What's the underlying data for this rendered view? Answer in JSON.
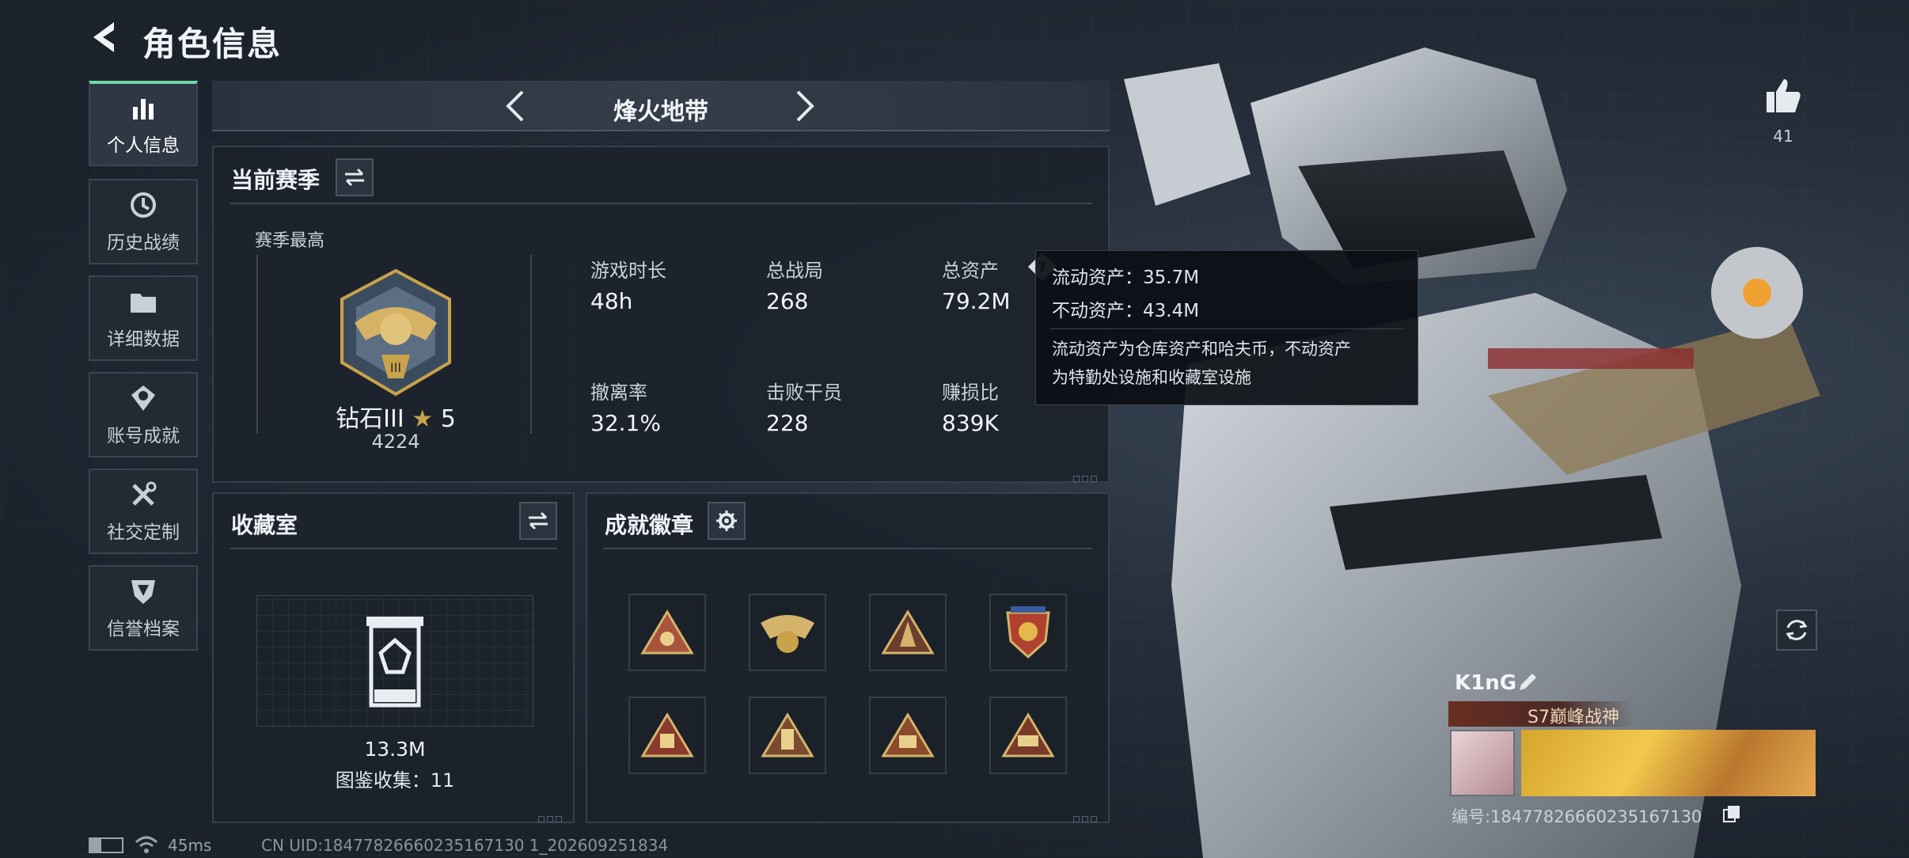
{
  "header": {
    "title": "角色信息"
  },
  "sidebar": {
    "items": [
      {
        "label": "个人信息",
        "icon": "bar-chart-icon",
        "active": true
      },
      {
        "label": "历史战绩",
        "icon": "clock-icon",
        "active": false
      },
      {
        "label": "详细数据",
        "icon": "folder-icon",
        "active": false
      },
      {
        "label": "账号成就",
        "icon": "medal-icon",
        "active": false
      },
      {
        "label": "社交定制",
        "icon": "wrench-icon",
        "active": false
      },
      {
        "label": "信誉档案",
        "icon": "shield-icon",
        "active": false
      }
    ]
  },
  "mode": {
    "label": "烽火地带"
  },
  "season": {
    "title": "当前赛季",
    "best_label": "赛季最高",
    "rank_name": "钻石III",
    "rank_stars": "5",
    "rank_score": "4224",
    "stats": [
      {
        "label": "游戏时长",
        "value": "48h"
      },
      {
        "label": "总战局",
        "value": "268"
      },
      {
        "label": "总资产",
        "value": "79.2M"
      },
      {
        "label": "撤离率",
        "value": "32.1%"
      },
      {
        "label": "击败干员",
        "value": "228"
      },
      {
        "label": "赚损比",
        "value": "839K"
      }
    ]
  },
  "tooltip": {
    "liquid": "流动资产：35.7M",
    "fixed": "不动资产：43.4M",
    "desc_line1": "流动资产为仓库资产和哈夫币，不动资产",
    "desc_line2": "为特勤处设施和收藏室设施"
  },
  "collection": {
    "title": "收藏室",
    "value": "13.3M",
    "codex": "图鉴收集：11"
  },
  "badges": {
    "title": "成就徽章",
    "count": 8
  },
  "likes": {
    "count": "41"
  },
  "player": {
    "name": "K1nG",
    "title": "S7巅峰战神",
    "id_text": "编号:18477826660235167130"
  },
  "status": {
    "ping": "45ms",
    "uid": "CN UID:18477826660235167130 1_202609251834"
  },
  "colors": {
    "accent": "#6fd7a8",
    "gold": "#c9a24a",
    "panel": "#1c232d"
  }
}
